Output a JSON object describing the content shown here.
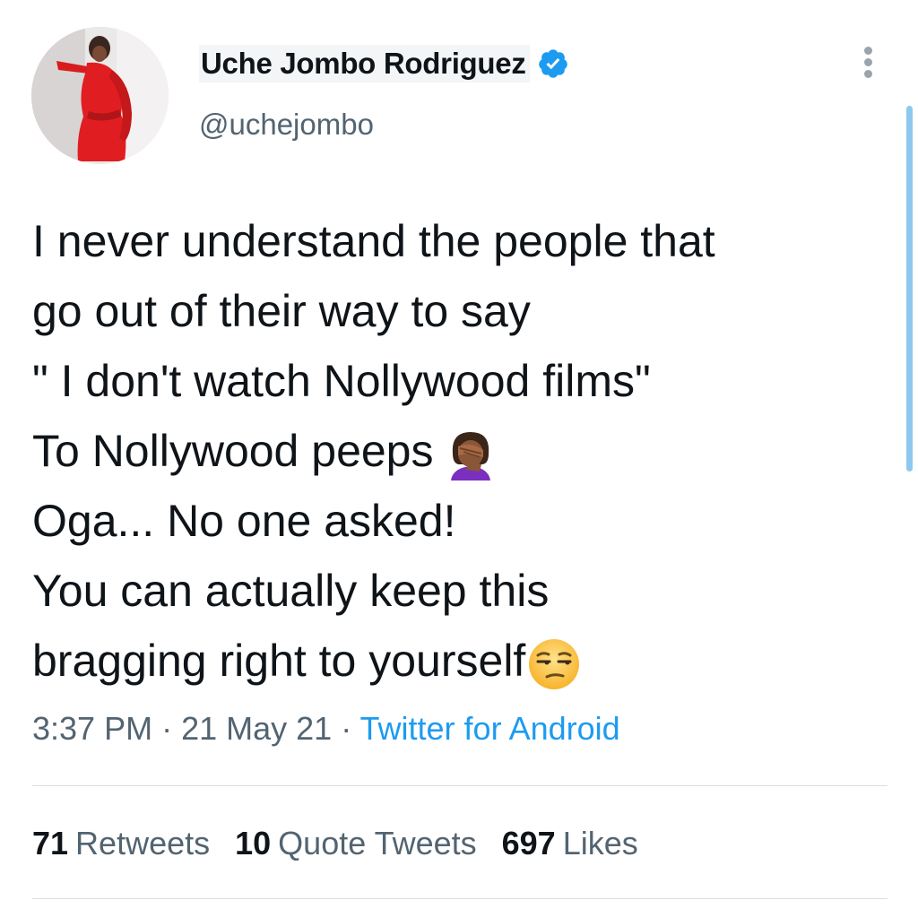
{
  "tweet": {
    "author": {
      "display_name": "Uche Jombo Rodriguez",
      "handle": "@uchejombo",
      "verified": true,
      "avatar": "profile-photo"
    },
    "text_lines": [
      "I never understand the people that",
      "go out of their way to say",
      "\" I don't watch Nollywood films\"",
      "To Nollywood peeps",
      "Oga... No one asked!",
      "You can actually keep this",
      "bragging right to yourself"
    ],
    "emojis": {
      "line_4": "woman-facepalming-emoji",
      "line_7": "unamused-face-emoji"
    },
    "meta": {
      "time": "3:37 PM",
      "separator_1": " · ",
      "date": "21 May 21",
      "separator_2": " · ",
      "source": "Twitter for Android"
    },
    "stats": [
      {
        "count": "71",
        "label": "Retweets"
      },
      {
        "count": "10",
        "label": "Quote Tweets"
      },
      {
        "count": "697",
        "label": "Likes"
      }
    ]
  },
  "icons": {
    "more_options": "more-vertical-icon",
    "verified_badge": "verified-badge-icon"
  },
  "colors": {
    "text_primary": "#0f1419",
    "text_secondary": "#536471",
    "link": "#1d9bf0",
    "verified": "#1d9bf0",
    "divider": "#d8dee3"
  }
}
